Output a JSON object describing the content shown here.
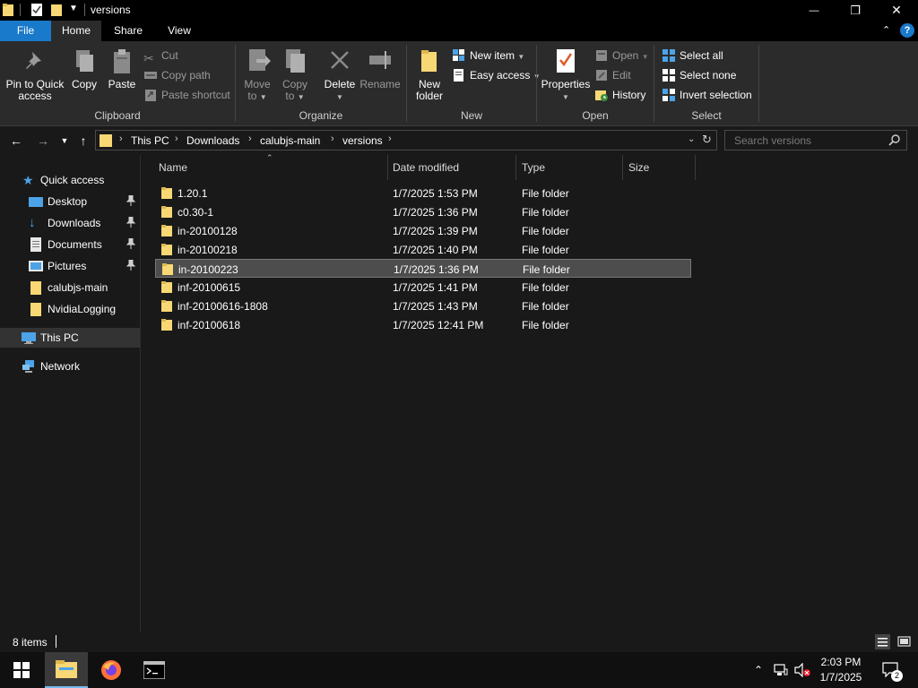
{
  "window": {
    "title": "versions",
    "minimize_glyph": "—",
    "restore_glyph": "❐",
    "close_glyph": "✕"
  },
  "ribbon_tabs": {
    "file": "File",
    "home": "Home",
    "share": "Share",
    "view": "View"
  },
  "ribbon": {
    "clipboard": {
      "group_label": "Clipboard",
      "pin_label_1": "Pin to Quick",
      "pin_label_2": "access",
      "copy": "Copy",
      "paste": "Paste",
      "cut": "Cut",
      "copy_path": "Copy path",
      "paste_shortcut": "Paste shortcut"
    },
    "organize": {
      "group_label": "Organize",
      "move_to_1": "Move",
      "move_to_2": "to",
      "copy_to_1": "Copy",
      "copy_to_2": "to",
      "delete": "Delete",
      "rename": "Rename"
    },
    "new": {
      "group_label": "New",
      "new_folder_1": "New",
      "new_folder_2": "folder",
      "new_item": "New item",
      "easy_access": "Easy access"
    },
    "open": {
      "group_label": "Open",
      "properties": "Properties",
      "open": "Open",
      "edit": "Edit",
      "history": "History"
    },
    "select": {
      "group_label": "Select",
      "select_all": "Select all",
      "select_none": "Select none",
      "invert_selection": "Invert selection"
    }
  },
  "address_bar": {
    "breadcrumbs": [
      "This PC",
      "Downloads",
      "calubjs-main",
      "versions"
    ],
    "search_placeholder": "Search versions"
  },
  "nav_pane": {
    "quick_access": "Quick access",
    "items": [
      {
        "label": "Desktop",
        "pinned": true
      },
      {
        "label": "Downloads",
        "pinned": true
      },
      {
        "label": "Documents",
        "pinned": true
      },
      {
        "label": "Pictures",
        "pinned": true
      },
      {
        "label": "calubjs-main",
        "pinned": false
      },
      {
        "label": "NvidiaLogging",
        "pinned": false
      }
    ],
    "this_pc": "This PC",
    "network": "Network"
  },
  "columns": {
    "name": "Name",
    "date_modified": "Date modified",
    "type": "Type",
    "size": "Size"
  },
  "files": [
    {
      "name": "1.20.1",
      "date": "1/7/2025 1:53 PM",
      "type": "File folder",
      "selected": false
    },
    {
      "name": "c0.30-1",
      "date": "1/7/2025 1:36 PM",
      "type": "File folder",
      "selected": false
    },
    {
      "name": "in-20100128",
      "date": "1/7/2025 1:39 PM",
      "type": "File folder",
      "selected": false
    },
    {
      "name": "in-20100218",
      "date": "1/7/2025 1:40 PM",
      "type": "File folder",
      "selected": false
    },
    {
      "name": "in-20100223",
      "date": "1/7/2025 1:36 PM",
      "type": "File folder",
      "selected": true
    },
    {
      "name": "inf-20100615",
      "date": "1/7/2025 1:41 PM",
      "type": "File folder",
      "selected": false
    },
    {
      "name": "inf-20100616-1808",
      "date": "1/7/2025 1:43 PM",
      "type": "File folder",
      "selected": false
    },
    {
      "name": "inf-20100618",
      "date": "1/7/2025 12:41 PM",
      "type": "File folder",
      "selected": false
    }
  ],
  "status": {
    "item_count": "8 items"
  },
  "taskbar": {
    "time": "2:03 PM",
    "date": "1/7/2025",
    "notification_count": "2"
  },
  "colors": {
    "accent": "#1979ca",
    "folder": "#f8d775",
    "background": "#191919",
    "ribbon": "#2b2b2b"
  }
}
